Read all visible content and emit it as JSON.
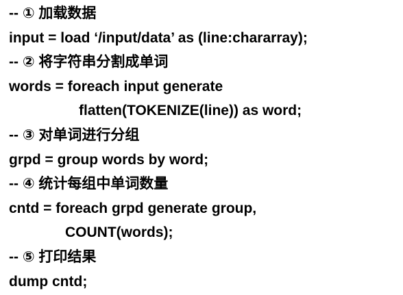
{
  "document": {
    "lines": [
      "-- ① 加载数据",
      "input = load ‘/input/data’ as (line:chararray);",
      "-- ② 将字符串分割成单词",
      "words = foreach input generate",
      "flatten(TOKENIZE(line)) as word;",
      "-- ③ 对单词进行分组",
      "grpd = group words by word;",
      "-- ④ 统计每组中单词数量",
      "cntd = foreach grpd generate group,",
      "COUNT(words);",
      "-- ⑤ 打印结果",
      "dump cntd;"
    ]
  }
}
